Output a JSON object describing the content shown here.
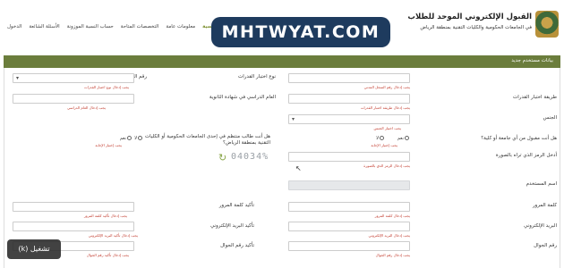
{
  "header": {
    "brand_title": "القبول الإلكتروني الموحد للطلاب",
    "brand_subtitle": "في الجامعات الحكومية والكليات التقنية بمنطقة الرياض",
    "watermark": "MHTWYAT.COM",
    "nav": [
      "الرئيسية",
      "معلومات عامة",
      "التخصصات المتاحة",
      "حساب النسبة الموزونة",
      "الأسئلة الشائعة",
      "الدخول"
    ]
  },
  "section_title": "بيانات مستخدم جديد",
  "right_col": {
    "national_id_label": "رقم السجل المدني",
    "national_id_err": "يجب إدخال رقم السجل المدني",
    "test_method_label": "طريقة اختبار القدرات",
    "test_method_err": "يجب إدخال طريقة اختبار القدرات",
    "gender_label": "الجنس",
    "gender_err": "يجب اختيار الجنس",
    "accepted_label": "هل أنت مقبول من أي جامعة أو كلية؟",
    "yes": "نعم",
    "no": "لا",
    "accepted_err": "يجب إختيار الإجابة",
    "phrase_label": "أدخل الرمز الذي تراه بالصورة",
    "phrase_err": "يجب إدخال الرمز الذي بالصورة",
    "username_label": "اسم المستخدم",
    "password_label": "كلمة المرور",
    "password_err": "يجب إدخال كلمة المرور",
    "email_label": "البريد الإلكتروني",
    "email_err": "يجب إدخال البريد الإلكتروني",
    "mobile_label": "رقم الجوال",
    "mobile_err": "يجب إدخال رقم الجوال"
  },
  "left_col": {
    "ability_type_label": "نوع اختبار القدرات",
    "ability_type_err": "يجب إدخال نوع اختبار القدرات",
    "grad_year_label": "العام الدراسي في شهادة الثانوية",
    "grad_year_err": "يجب إدخال العام الدراسي",
    "enrolled_label": "هل أنت طالب منتظم في إحدى الجامعات الحكومية أو الكليات التقنية بمنطقة الرياض؟",
    "yes": "نعم",
    "no": "لا",
    "enrolled_err": "يجب إختيار الإجابة",
    "confirm_password_label": "تأكيد كلمة المرور",
    "confirm_password_err": "يجب إدخال تأكيد كلمة المرور",
    "confirm_email_label": "تأكيد البريد الإلكتروني",
    "confirm_email_err": "يجب إدخال تأكيد البريد الإلكتروني",
    "confirm_mobile_label": "تأكيد رقم الجوال",
    "confirm_mobile_err": "يجب إدخال تأكيد رقم الجوال"
  },
  "captcha_text": "04034%",
  "keyhint": "تشغيل (k)"
}
